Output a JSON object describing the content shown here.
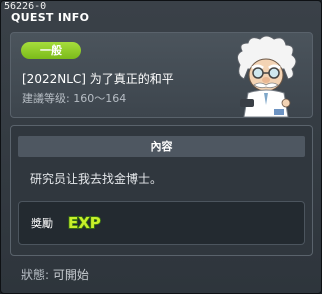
{
  "window": {
    "code": "56226-0",
    "title": "QUEST INFO"
  },
  "quest": {
    "category": "一般",
    "name": "[2022NLC] 为了真正的和平",
    "level_label": "建議等级:",
    "level_range": "160～164",
    "npc_icon": "old-scientist-npc-icon"
  },
  "content": {
    "header": "內容",
    "description": "研究员让我去找金博士。"
  },
  "reward": {
    "label": "獎勵",
    "icon": "exp-icon",
    "icon_text": "EXP"
  },
  "status": {
    "label": "狀態:",
    "value": "可開始"
  },
  "colors": {
    "badge": "#8cc927",
    "exp_fill": "#c7ef2a",
    "exp_outline": "#3b7a10"
  }
}
